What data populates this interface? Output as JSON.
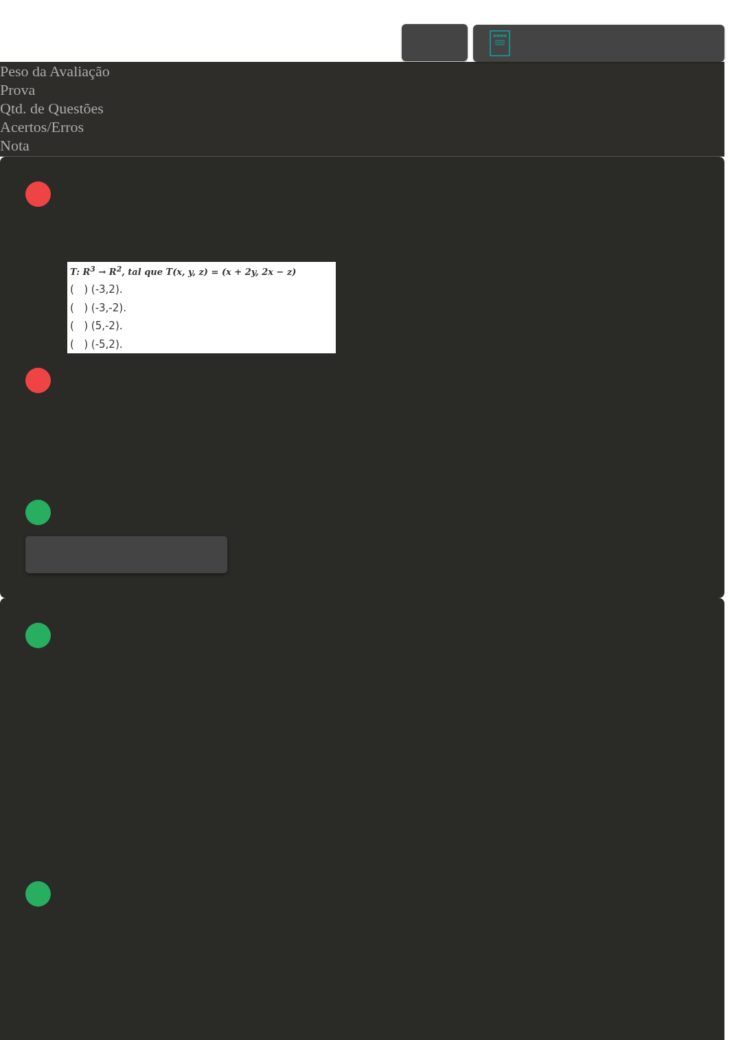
{
  "toolbar": {
    "buttons": [
      {
        "kind": "blank"
      },
      {
        "kind": "document"
      }
    ]
  },
  "summary_labels": [
    "Peso da Avaliação",
    "Prova",
    "Qtd. de Questões",
    "Acertos/Erros",
    "Nota"
  ],
  "cards": [
    {
      "items": [
        {
          "kind": "marker",
          "color": "#ef4444"
        },
        {
          "kind": "figure",
          "lines": [
            "T: R$^{3}$ → R$^{2}$, tal que T(x, y, z) = (x + 2y, 2x − z)",
            "(   ) (-3,2).",
            "(   ) (-3,-2).",
            "(   ) (5,-2).",
            "(   ) (-5,2)."
          ]
        },
        {
          "kind": "marker",
          "color": "#ef4444"
        },
        {
          "kind": "marker",
          "color": "#27ae60"
        },
        {
          "kind": "button"
        }
      ]
    },
    {
      "items": [
        {
          "kind": "marker",
          "color": "#27ae60"
        },
        {
          "kind": "marker",
          "color": "#27ae60"
        }
      ]
    }
  ]
}
